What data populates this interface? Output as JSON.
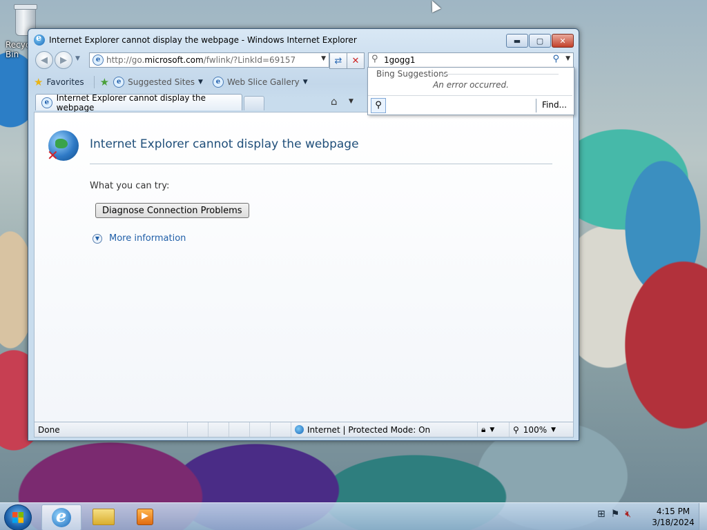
{
  "desktop": {
    "recycle_bin_label": "Recycle Bin"
  },
  "window": {
    "title": "Internet Explorer cannot display the webpage - Windows Internet Explorer",
    "minimize_glyph": "▬",
    "maximize_glyph": "▢",
    "close_glyph": "✕"
  },
  "nav": {
    "back_glyph": "◀",
    "forward_glyph": "▶",
    "address_prefix": "http://go.",
    "address_host": "microsoft.com",
    "address_suffix": "/fwlink/?LinkId=69157",
    "refresh_glyph": "⇄",
    "stop_glyph": "✕"
  },
  "search": {
    "value": "1gogg1",
    "dropdown_header": "Bing Suggestions",
    "error_text": "An error occurred.",
    "find_label": "Find..."
  },
  "favorites_bar": {
    "favorites_label": "Favorites",
    "suggested_sites_label": "Suggested Sites",
    "web_slice_label": "Web Slice Gallery"
  },
  "tab": {
    "label": "Internet Explorer cannot display the webpage"
  },
  "content": {
    "heading": "Internet Explorer cannot display the webpage",
    "what_you_can_try": "What you can try:",
    "diagnose_button": "Diagnose Connection Problems",
    "more_information": "More information"
  },
  "statusbar": {
    "status_text": "Done",
    "zone_text": "Internet | Protected Mode: On",
    "zoom": "100%"
  },
  "taskbar": {
    "time": "4:15 PM",
    "date": "3/18/2024"
  },
  "colors": {
    "link_blue": "#1f5fa8",
    "heading_blue": "#1f4e79",
    "close_red": "#c2412b"
  },
  "icons": [
    "recycle-bin-icon",
    "ie-icon",
    "globe-error-icon",
    "search-icon",
    "star-icon",
    "home-icon",
    "windows-start-icon",
    "folder-icon",
    "media-player-icon",
    "network-icon",
    "flag-icon",
    "volume-muted-icon"
  ]
}
